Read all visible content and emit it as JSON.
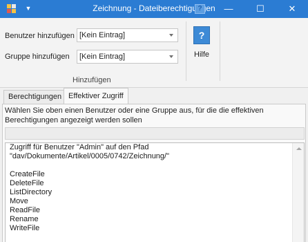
{
  "window": {
    "title": "Zeichnung - Dateiberechtigungen",
    "help_mini_label": "?",
    "controls": {
      "minimize": "—",
      "maximize": "☐",
      "close": "✕"
    }
  },
  "ribbon": {
    "user_label": "Benutzer hinzufügen",
    "user_value": "[Kein Eintrag]",
    "group_label": "Gruppe hinzufügen",
    "group_value": "[Kein Eintrag]",
    "group_caption": "Hinzufügen",
    "help_icon_glyph": "?",
    "help_label": "Hilfe"
  },
  "tabs": [
    {
      "label": "Berechtigungen",
      "active": false
    },
    {
      "label": "Effektiver Zugriff",
      "active": true
    }
  ],
  "effective_access": {
    "description": "Wählen Sie oben einen Benutzer oder eine Gruppe aus, für die die effektiven Berechtigungen angezeigt werden sollen",
    "filter_value": "",
    "output": "Zugriff für Benutzer \"Admin\" auf den Pfad\n\"dav/Dokumente/Artikel/0005/0742/Zeichnung/\"\n\nCreateFile\nDeleteFile\nListDirectory\nMove\nReadFile\nRename\nWriteFile"
  },
  "icons": {
    "app": "app-grid-icon",
    "quick_access": "chevron-down-icon",
    "help": "help-question-icon",
    "scroll_up": "scroll-up-arrow-icon"
  },
  "colors": {
    "titlebar": "#2b7cd3",
    "help_button": "#3d8ad6",
    "panel": "#f9f9f9"
  }
}
